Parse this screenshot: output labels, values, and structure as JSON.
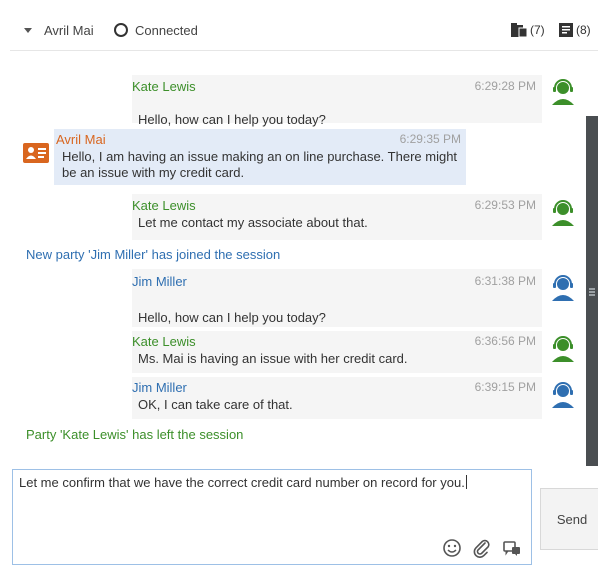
{
  "header": {
    "contact_name": "Avril Mai",
    "status": "Connected",
    "counter_a": "(7)",
    "counter_b": "(8)"
  },
  "messages": [
    {
      "sender": "Kate Lewis",
      "time": "6:29:28 PM",
      "text": "Hello, how can I help you today?",
      "role": "agent-green"
    },
    {
      "sender": "Avril Mai",
      "time": "6:29:35 PM",
      "text": "Hello, I am having an issue making an on line purchase. There might be an issue with my credit card.",
      "role": "customer"
    },
    {
      "sender": "Kate Lewis",
      "time": "6:29:53 PM",
      "text": "Let me contact my associate about that.",
      "role": "agent-green"
    },
    {
      "system": "New party 'Jim Miller' has joined the session"
    },
    {
      "sender": "Jim Miller",
      "time": "6:31:38 PM",
      "text": "Hello, how can I help you today?",
      "role": "agent-blue"
    },
    {
      "sender": "Kate Lewis",
      "time": "6:36:56 PM",
      "text": "Ms. Mai is having an issue with her credit card.",
      "role": "agent-green"
    },
    {
      "sender": "Jim Miller",
      "time": "6:39:15 PM",
      "text": "OK, I can take care of that.",
      "role": "agent-blue"
    },
    {
      "system": "Party 'Kate Lewis' has left the session"
    }
  ],
  "composer": {
    "value": "Let me confirm that we have the correct credit card number on record for you."
  },
  "send_label": "Send",
  "colors": {
    "agent_green": "#3c8f2a",
    "agent_blue": "#2f6fb1",
    "customer_orange": "#d9661f",
    "customer_bubble": "#e3ebf7",
    "agent_bubble": "#f5f5f5"
  }
}
